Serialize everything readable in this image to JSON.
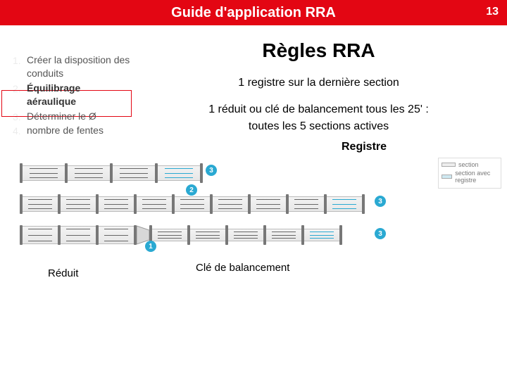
{
  "header": {
    "title": "Guide d'application RRA",
    "page": "13"
  },
  "sidebar": {
    "items": [
      {
        "num": "1.",
        "text": "Créer la disposition des conduits",
        "bold": false
      },
      {
        "num": "2.",
        "text": "Équilibrage aéraulique",
        "bold": true
      },
      {
        "num": "3.",
        "text": "Déterminer le Ø",
        "bold": false
      },
      {
        "num": "4.",
        "text": "nombre de fentes",
        "bold": false
      }
    ]
  },
  "main": {
    "heading": "Règles RRA",
    "rule1": "1 registre sur la dernière section",
    "rule2a": "1 réduit ou clé de balancement tous les 25' :",
    "rule2b": "toutes les 5 sections actives",
    "label_registre": "Registre",
    "label_reduit": "Réduit",
    "label_cle": "Clé de balancement",
    "legend": {
      "a": "section",
      "b": "section avec registre"
    },
    "markers": {
      "m1": "1",
      "m2": "2",
      "m3": "3"
    }
  }
}
